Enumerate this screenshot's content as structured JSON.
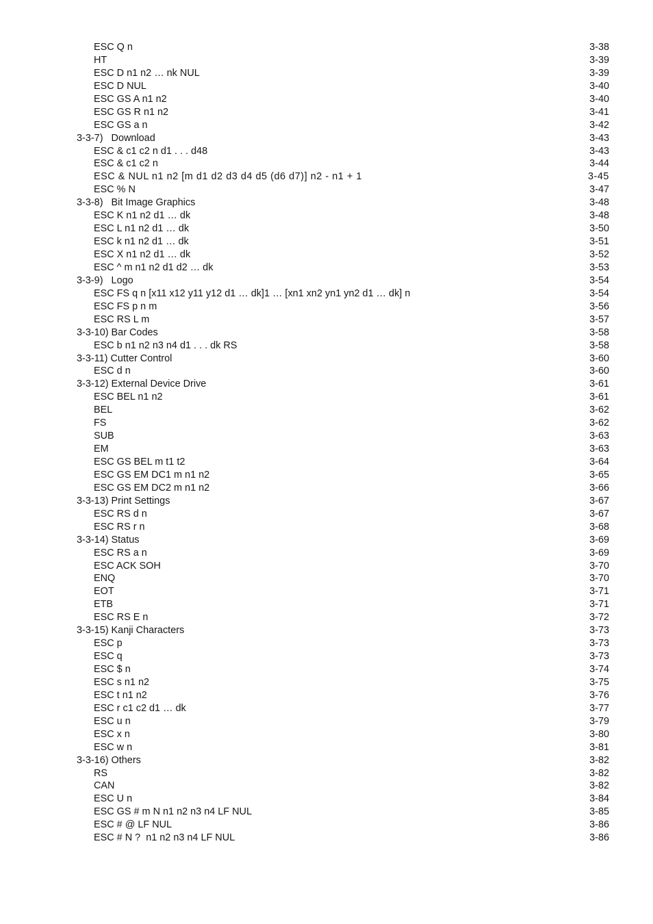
{
  "document": {
    "type": "table-of-contents",
    "page_background": "#ffffff",
    "text_color": "#161616"
  },
  "toc": {
    "entries": [
      {
        "label": "ESC Q n",
        "page": "3-38",
        "level": "entry"
      },
      {
        "label": "HT",
        "page": "3-39",
        "level": "entry"
      },
      {
        "label": "ESC D n1 n2 … nk NUL",
        "page": "3-39",
        "level": "entry"
      },
      {
        "label": "ESC D NUL",
        "page": "3-40",
        "level": "entry"
      },
      {
        "label": "ESC GS A n1 n2",
        "page": "3-40",
        "level": "entry"
      },
      {
        "label": "ESC GS R n1 n2",
        "page": "3-41",
        "level": "entry"
      },
      {
        "label": "ESC GS a n",
        "page": "3-42",
        "level": "entry"
      },
      {
        "label": "3-3-7)   Download",
        "page": "3-43",
        "level": "section"
      },
      {
        "label": "ESC & c1 c2 n d1 . . . d48",
        "page": "3-43",
        "level": "entry"
      },
      {
        "label": "ESC & c1 c2 n",
        "page": "3-44",
        "level": "entry"
      },
      {
        "label": "ESC & NUL n1 n2 [m d1 d2 d3 d4 d5 (d6 d7)] n2 - n1 + 1",
        "page": "3-45",
        "level": "entry",
        "wide": true
      },
      {
        "label": "ESC % N",
        "page": "3-47",
        "level": "entry"
      },
      {
        "label": "3-3-8)   Bit Image Graphics",
        "page": "3-48",
        "level": "section"
      },
      {
        "label": "ESC K n1 n2 d1 … dk",
        "page": "3-48",
        "level": "entry"
      },
      {
        "label": "ESC L n1 n2 d1 … dk",
        "page": "3-50",
        "level": "entry"
      },
      {
        "label": "ESC k n1 n2 d1 … dk",
        "page": "3-51",
        "level": "entry"
      },
      {
        "label": "ESC X n1 n2 d1 … dk",
        "page": "3-52",
        "level": "entry"
      },
      {
        "label": "ESC ^ m n1 n2 d1 d2 … dk",
        "page": "3-53",
        "level": "entry"
      },
      {
        "label": "3-3-9)   Logo",
        "page": "3-54",
        "level": "section"
      },
      {
        "label": "ESC FS q n [x11 x12 y11 y12 d1 … dk]1 … [xn1 xn2 yn1 yn2 d1 … dk] n",
        "page": "3-54",
        "level": "entry"
      },
      {
        "label": "ESC FS p n m",
        "page": "3-56",
        "level": "entry"
      },
      {
        "label": "ESC RS L m",
        "page": "3-57",
        "level": "entry"
      },
      {
        "label": "3-3-10) Bar Codes",
        "page": "3-58",
        "level": "section"
      },
      {
        "label": "ESC b n1 n2 n3 n4 d1 . . . dk RS",
        "page": "3-58",
        "level": "entry"
      },
      {
        "label": "3-3-11) Cutter Control",
        "page": "3-60",
        "level": "section"
      },
      {
        "label": "ESC d n",
        "page": "3-60",
        "level": "entry"
      },
      {
        "label": "3-3-12) External Device Drive",
        "page": "3-61",
        "level": "section"
      },
      {
        "label": "ESC BEL n1 n2",
        "page": "3-61",
        "level": "entry"
      },
      {
        "label": "BEL",
        "page": "3-62",
        "level": "entry"
      },
      {
        "label": "FS",
        "page": "3-62",
        "level": "entry"
      },
      {
        "label": "SUB",
        "page": "3-63",
        "level": "entry"
      },
      {
        "label": "EM",
        "page": "3-63",
        "level": "entry"
      },
      {
        "label": "ESC GS BEL m t1 t2",
        "page": "3-64",
        "level": "entry"
      },
      {
        "label": "ESC GS EM DC1 m n1 n2",
        "page": "3-65",
        "level": "entry"
      },
      {
        "label": "ESC GS EM DC2 m n1 n2",
        "page": "3-66",
        "level": "entry"
      },
      {
        "label": "3-3-13) Print Settings",
        "page": "3-67",
        "level": "section"
      },
      {
        "label": "ESC RS d n",
        "page": "3-67",
        "level": "entry"
      },
      {
        "label": "ESC RS r n",
        "page": "3-68",
        "level": "entry"
      },
      {
        "label": "3-3-14) Status",
        "page": "3-69",
        "level": "section"
      },
      {
        "label": "ESC RS a n",
        "page": "3-69",
        "level": "entry"
      },
      {
        "label": "ESC ACK SOH",
        "page": "3-70",
        "level": "entry"
      },
      {
        "label": "ENQ",
        "page": "3-70",
        "level": "entry"
      },
      {
        "label": "EOT",
        "page": "3-71",
        "level": "entry"
      },
      {
        "label": "ETB",
        "page": "3-71",
        "level": "entry"
      },
      {
        "label": "ESC RS E n",
        "page": "3-72",
        "level": "entry"
      },
      {
        "label": "3-3-15) Kanji Characters",
        "page": "3-73",
        "level": "section"
      },
      {
        "label": "ESC p",
        "page": "3-73",
        "level": "entry"
      },
      {
        "label": "ESC q",
        "page": "3-73",
        "level": "entry"
      },
      {
        "label": "ESC $ n",
        "page": "3-74",
        "level": "entry"
      },
      {
        "label": "ESC s n1 n2",
        "page": "3-75",
        "level": "entry"
      },
      {
        "label": "ESC t n1 n2",
        "page": "3-76",
        "level": "entry"
      },
      {
        "label": "ESC r c1 c2 d1 … dk",
        "page": "3-77",
        "level": "entry"
      },
      {
        "label": "ESC u n",
        "page": "3-79",
        "level": "entry"
      },
      {
        "label": "ESC x n",
        "page": "3-80",
        "level": "entry"
      },
      {
        "label": "ESC w n",
        "page": "3-81",
        "level": "entry"
      },
      {
        "label": "3-3-16) Others",
        "page": "3-82",
        "level": "section"
      },
      {
        "label": "RS",
        "page": "3-82",
        "level": "entry"
      },
      {
        "label": "CAN",
        "page": "3-82",
        "level": "entry"
      },
      {
        "label": "ESC U n",
        "page": "3-84",
        "level": "entry"
      },
      {
        "label": "ESC GS # m N n1 n2 n3 n4 LF NUL",
        "page": "3-85",
        "level": "entry"
      },
      {
        "label": "ESC # @ LF NUL",
        "page": "3-86",
        "level": "entry"
      },
      {
        "label": "ESC # N ?  n1 n2 n3 n4 LF NUL",
        "page": "3-86",
        "level": "entry"
      }
    ]
  }
}
